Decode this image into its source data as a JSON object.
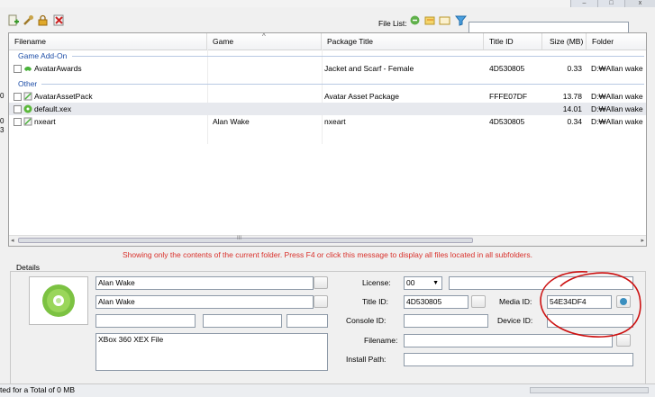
{
  "toolbar": {
    "file_list_label": "File List:",
    "icons": [
      "add-file-icon",
      "wrench-icon",
      "lock-icon",
      "delete-icon"
    ],
    "filelist_icons": [
      "recycle-icon",
      "folder-tree-icon",
      "folder-icon",
      "filter-icon"
    ],
    "search_value": ""
  },
  "window": {
    "minimize": "–",
    "maximize": "□",
    "close": "x"
  },
  "grid": {
    "columns": [
      "Filename",
      "Game",
      "Package Title",
      "Title ID",
      "Size (MB)",
      "Folder"
    ],
    "sort_indicator": "^",
    "groups": [
      {
        "label": "Game Add-On",
        "rows": [
          {
            "filename": "AvatarAwards",
            "game": "",
            "package_title": "Jacket and Scarf - Female",
            "title_id": "4D530805",
            "size": "0.33",
            "folder": "D:₩Allan wake"
          }
        ]
      },
      {
        "label": "Other",
        "rows": [
          {
            "filename": "AvatarAssetPack",
            "game": "",
            "package_title": "Avatar Asset Package",
            "title_id": "FFFE07DF",
            "size": "13.78",
            "folder": "D:₩Allan wake"
          },
          {
            "filename": "default.xex",
            "game": "",
            "package_title": "",
            "title_id": "",
            "size": "14.01",
            "folder": "D:₩Allan wake"
          },
          {
            "filename": "nxeart",
            "game": "Alan Wake",
            "package_title": "nxeart",
            "title_id": "4D530805",
            "size": "0.34",
            "folder": "D:₩Allan wake"
          }
        ]
      }
    ],
    "scroll_marker": "III"
  },
  "notice": "Showing only the contents of the current folder. Press F4 or click this message to display all files located in all subfolders.",
  "details": {
    "label": "Details",
    "name1": "Alan Wake",
    "name2": "Alan Wake",
    "description": "XBox 360 XEX File",
    "license_label": "License:",
    "license_value": "00",
    "title_id_label": "Title ID:",
    "title_id_value": "4D530805",
    "media_id_label": "Media ID:",
    "media_id_value": "54E34DF4",
    "console_id_label": "Console ID:",
    "device_id_label": "Device ID:",
    "filename_label": "Filename:",
    "install_path_label": "Install Path:"
  },
  "status": {
    "text": "ted for a Total of 0 MB"
  },
  "left_stubs": [
    "0",
    "0",
    "3"
  ],
  "colors": {
    "notice": "#d9312b",
    "group": "#1f4fa8",
    "annotation": "#cc1111"
  }
}
